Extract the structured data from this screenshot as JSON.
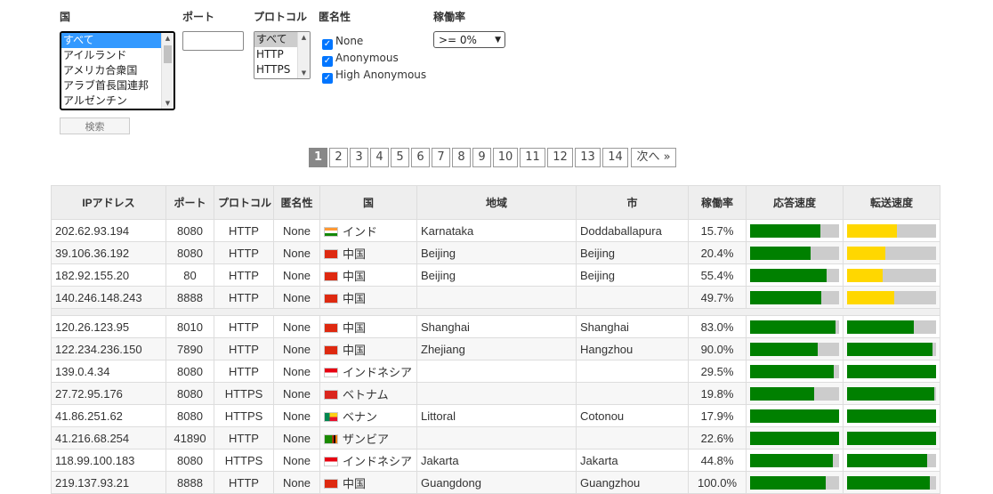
{
  "filters": {
    "country_label": "国",
    "port_label": "ポート",
    "protocol_label": "プロトコル",
    "anonymity_label": "匿名性",
    "uptime_label": "稼働率",
    "countries": [
      "すべて",
      "アイルランド",
      "アメリカ合衆国",
      "アラブ首長国連邦",
      "アルゼンチン"
    ],
    "port_value": "",
    "protocols": [
      "すべて",
      "HTTP",
      "HTTPS"
    ],
    "anonymity_options": [
      "None",
      "Anonymous",
      "High Anonymous"
    ],
    "uptime_selected": ">= 0%",
    "search_button": "検索"
  },
  "pagination": {
    "pages": [
      "1",
      "2",
      "3",
      "4",
      "5",
      "6",
      "7",
      "8",
      "9",
      "10",
      "11",
      "12",
      "13",
      "14"
    ],
    "current": "1",
    "next": "次へ »"
  },
  "table": {
    "headers": [
      "IPアドレス",
      "ポート",
      "プロトコル",
      "匿名性",
      "国",
      "地域",
      "市",
      "稼働率",
      "応答速度",
      "転送速度"
    ],
    "rows": [
      {
        "ip": "202.62.93.194",
        "port": "8080",
        "protocol": "HTTP",
        "anon": "None",
        "flag": "india-flag",
        "country": "インド",
        "region": "Karnataka",
        "city": "Doddaballapura",
        "uptime": "15.7%",
        "response": 0.79,
        "response_color": "#008000",
        "transfer": 0.56,
        "transfer_color": "#ffd700"
      },
      {
        "ip": "39.106.36.192",
        "port": "8080",
        "protocol": "HTTP",
        "anon": "None",
        "flag": "china-flag",
        "country": "中国",
        "region": "Beijing",
        "city": "Beijing",
        "uptime": "20.4%",
        "response": 0.68,
        "response_color": "#008000",
        "transfer": 0.43,
        "transfer_color": "#ffd700"
      },
      {
        "ip": "182.92.155.20",
        "port": "80",
        "protocol": "HTTP",
        "anon": "None",
        "flag": "china-flag",
        "country": "中国",
        "region": "Beijing",
        "city": "Beijing",
        "uptime": "55.4%",
        "response": 0.86,
        "response_color": "#008000",
        "transfer": 0.4,
        "transfer_color": "#ffd700"
      },
      {
        "ip": "140.246.148.243",
        "port": "8888",
        "protocol": "HTTP",
        "anon": "None",
        "flag": "china-flag",
        "country": "中国",
        "region": "",
        "city": "",
        "uptime": "49.7%",
        "response": 0.8,
        "response_color": "#008000",
        "transfer": 0.53,
        "transfer_color": "#ffd700"
      },
      {
        "ip": "120.26.123.95",
        "port": "8010",
        "protocol": "HTTP",
        "anon": "None",
        "flag": "china-flag",
        "country": "中国",
        "region": "Shanghai",
        "city": "Shanghai",
        "uptime": "83.0%",
        "response": 0.96,
        "response_color": "#008000",
        "transfer": 0.75,
        "transfer_color": "#008000"
      },
      {
        "ip": "122.234.236.150",
        "port": "7890",
        "protocol": "HTTP",
        "anon": "None",
        "flag": "china-flag",
        "country": "中国",
        "region": "Zhejiang",
        "city": "Hangzhou",
        "uptime": "90.0%",
        "response": 0.76,
        "response_color": "#008000",
        "transfer": 0.96,
        "transfer_color": "#008000"
      },
      {
        "ip": "139.0.4.34",
        "port": "8080",
        "protocol": "HTTP",
        "anon": "None",
        "flag": "indonesia-flag",
        "country": "インドネシア",
        "region": "",
        "city": "",
        "uptime": "29.5%",
        "response": 0.94,
        "response_color": "#008000",
        "transfer": 1.0,
        "transfer_color": "#008000"
      },
      {
        "ip": "27.72.95.176",
        "port": "8080",
        "protocol": "HTTPS",
        "anon": "None",
        "flag": "vietnam-flag",
        "country": "ベトナム",
        "region": "",
        "city": "",
        "uptime": "19.8%",
        "response": 0.72,
        "response_color": "#008000",
        "transfer": 0.98,
        "transfer_color": "#008000"
      },
      {
        "ip": "41.86.251.62",
        "port": "8080",
        "protocol": "HTTPS",
        "anon": "None",
        "flag": "benin-flag",
        "country": "ベナン",
        "region": "Littoral",
        "city": "Cotonou",
        "uptime": "17.9%",
        "response": 1.0,
        "response_color": "#008000",
        "transfer": 1.0,
        "transfer_color": "#008000"
      },
      {
        "ip": "41.216.68.254",
        "port": "41890",
        "protocol": "HTTP",
        "anon": "None",
        "flag": "zambia-flag",
        "country": "ザンビア",
        "region": "",
        "city": "",
        "uptime": "22.6%",
        "response": 1.0,
        "response_color": "#008000",
        "transfer": 1.0,
        "transfer_color": "#008000"
      },
      {
        "ip": "118.99.100.183",
        "port": "8080",
        "protocol": "HTTPS",
        "anon": "None",
        "flag": "indonesia-flag",
        "country": "インドネシア",
        "region": "Jakarta",
        "city": "Jakarta",
        "uptime": "44.8%",
        "response": 0.93,
        "response_color": "#008000",
        "transfer": 0.9,
        "transfer_color": "#008000"
      },
      {
        "ip": "219.137.93.21",
        "port": "8888",
        "protocol": "HTTP",
        "anon": "None",
        "flag": "china-flag",
        "country": "中国",
        "region": "Guangdong",
        "city": "Guangzhou",
        "uptime": "100.0%",
        "response": 0.85,
        "response_color": "#008000",
        "transfer": 0.93,
        "transfer_color": "#008000"
      }
    ]
  }
}
